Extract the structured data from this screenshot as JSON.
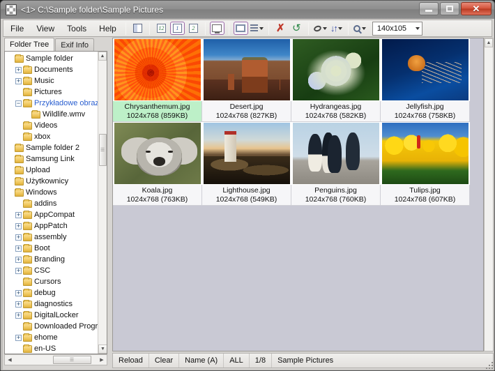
{
  "window": {
    "title": "<1> C:\\Sample folder\\Sample Pictures",
    "icon": "grid-icon",
    "controls": {
      "minimize": "minimize-icon",
      "maximize": "maximize-icon",
      "close": "close-icon"
    }
  },
  "menubar": {
    "items": [
      "File",
      "View",
      "Tools",
      "Help"
    ]
  },
  "toolbar": {
    "buttons": [
      {
        "name": "single-page-view",
        "icon": "page-icon",
        "framed": false
      },
      {
        "name": "page-12-view",
        "icon": "page-12-icon",
        "framed": false
      },
      {
        "name": "page-1-view",
        "icon": "page-1-icon",
        "framed": true
      },
      {
        "name": "page-2-view",
        "icon": "page-2-icon",
        "framed": false
      },
      {
        "name": "window-view",
        "icon": "monitor-icon",
        "framed": true
      },
      {
        "name": "thumbnail-view",
        "icon": "rect-icon",
        "framed": true
      },
      {
        "name": "list-view",
        "icon": "lines-icon",
        "framed": false
      },
      {
        "name": "delete",
        "icon": "x-icon",
        "framed": false
      },
      {
        "name": "refresh",
        "icon": "refresh-icon",
        "framed": false
      },
      {
        "name": "rotate",
        "icon": "ellipse-icon",
        "framed": false
      },
      {
        "name": "sort",
        "icon": "updown-arrows-icon",
        "framed": false
      },
      {
        "name": "zoom",
        "icon": "magnifier-icon",
        "framed": false
      }
    ],
    "size_value": "140x105"
  },
  "left_panel": {
    "tabs": [
      {
        "label": "Folder Tree",
        "active": true
      },
      {
        "label": "Exif Info",
        "active": false
      }
    ],
    "tree": [
      {
        "label": "Sample folder",
        "depth": 0,
        "expander": "none",
        "selected": false
      },
      {
        "label": "Documents",
        "depth": 1,
        "expander": "plus",
        "selected": false
      },
      {
        "label": "Music",
        "depth": 1,
        "expander": "plus",
        "selected": false
      },
      {
        "label": "Pictures",
        "depth": 1,
        "expander": "none",
        "selected": false
      },
      {
        "label": "Przykładowe obrazy",
        "depth": 1,
        "expander": "minus",
        "selected": true
      },
      {
        "label": "Wildlife.wmv",
        "depth": 2,
        "expander": "none",
        "selected": false
      },
      {
        "label": "Videos",
        "depth": 1,
        "expander": "none",
        "selected": false
      },
      {
        "label": "xbox",
        "depth": 1,
        "expander": "none",
        "selected": false
      },
      {
        "label": "Sample folder 2",
        "depth": 0,
        "expander": "none",
        "selected": false
      },
      {
        "label": "Samsung Link",
        "depth": 0,
        "expander": "none",
        "selected": false
      },
      {
        "label": "Upload",
        "depth": 0,
        "expander": "none",
        "selected": false
      },
      {
        "label": "Użytkownicy",
        "depth": 0,
        "expander": "none",
        "selected": false
      },
      {
        "label": "Windows",
        "depth": 0,
        "expander": "none",
        "selected": false
      },
      {
        "label": "addins",
        "depth": 1,
        "expander": "none",
        "selected": false
      },
      {
        "label": "AppCompat",
        "depth": 1,
        "expander": "plus",
        "selected": false
      },
      {
        "label": "AppPatch",
        "depth": 1,
        "expander": "plus",
        "selected": false
      },
      {
        "label": "assembly",
        "depth": 1,
        "expander": "plus",
        "selected": false
      },
      {
        "label": "Boot",
        "depth": 1,
        "expander": "plus",
        "selected": false
      },
      {
        "label": "Branding",
        "depth": 1,
        "expander": "plus",
        "selected": false
      },
      {
        "label": "CSC",
        "depth": 1,
        "expander": "plus",
        "selected": false
      },
      {
        "label": "Cursors",
        "depth": 1,
        "expander": "none",
        "selected": false
      },
      {
        "label": "debug",
        "depth": 1,
        "expander": "plus",
        "selected": false
      },
      {
        "label": "diagnostics",
        "depth": 1,
        "expander": "plus",
        "selected": false
      },
      {
        "label": "DigitalLocker",
        "depth": 1,
        "expander": "plus",
        "selected": false
      },
      {
        "label": "Downloaded Progra",
        "depth": 1,
        "expander": "none",
        "selected": false
      },
      {
        "label": "ehome",
        "depth": 1,
        "expander": "plus",
        "selected": false
      },
      {
        "label": "en-US",
        "depth": 1,
        "expander": "none",
        "selected": false
      }
    ]
  },
  "thumbnails": [
    {
      "name": "Chrysanthemum.jpg",
      "info": "1024x768 (859KB)",
      "art": "art-chrys",
      "selected": true
    },
    {
      "name": "Desert.jpg",
      "info": "1024x768 (827KB)",
      "art": "art-desert",
      "selected": false
    },
    {
      "name": "Hydrangeas.jpg",
      "info": "1024x768 (582KB)",
      "art": "art-hydr",
      "selected": false
    },
    {
      "name": "Jellyfish.jpg",
      "info": "1024x768 (758KB)",
      "art": "art-jelly",
      "selected": false
    },
    {
      "name": "Koala.jpg",
      "info": "1024x768 (763KB)",
      "art": "art-koala",
      "selected": false
    },
    {
      "name": "Lighthouse.jpg",
      "info": "1024x768 (549KB)",
      "art": "art-light",
      "selected": false
    },
    {
      "name": "Penguins.jpg",
      "info": "1024x768 (760KB)",
      "art": "art-peng",
      "selected": false
    },
    {
      "name": "Tulips.jpg",
      "info": "1024x768 (607KB)",
      "art": "art-tulip",
      "selected": false
    }
  ],
  "statusbar": {
    "reload": "Reload",
    "clear": "Clear",
    "sort": "Name (A)",
    "filter": "ALL",
    "counter": "1/8",
    "folder": "Sample Pictures"
  },
  "colors": {
    "selection_green": "#bdf0c8",
    "tree_selected_text": "#2a5fd0",
    "thumb_bg": "#c9c9d4",
    "close_red": "#d4523a",
    "toolbar_frame_purple": "#9b6ba8"
  }
}
